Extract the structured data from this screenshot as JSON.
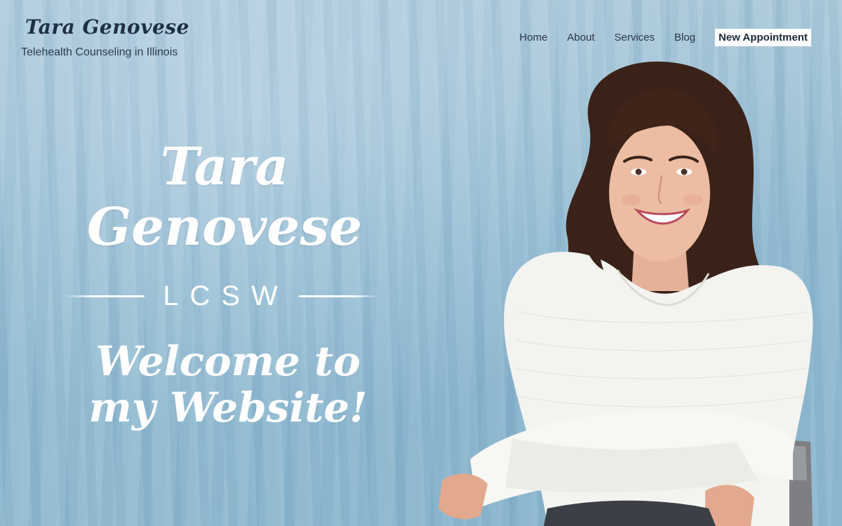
{
  "header": {
    "logo": "Tara Genovese",
    "tagline": "Telehealth Counseling in Illinois"
  },
  "nav": {
    "items": [
      "Home",
      "About",
      "Services",
      "Blog"
    ],
    "cta": "New Appointment"
  },
  "hero": {
    "name": "Tara Genovese",
    "credential": "LCSW",
    "welcome": "Welcome to my Website!"
  },
  "colors": {
    "background": "#94bcd2",
    "text_dark": "#1f2f45",
    "hero_text": "#ffffff",
    "cta_background": "#ffffff"
  }
}
